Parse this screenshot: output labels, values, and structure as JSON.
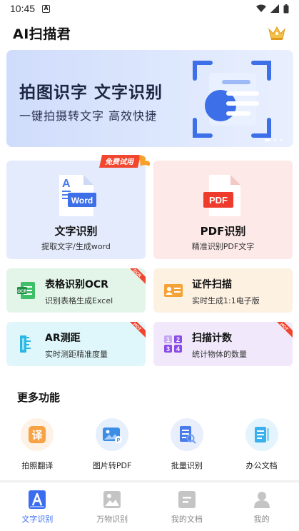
{
  "status_bar": {
    "time": "10:45",
    "notification_badge": "A"
  },
  "app": {
    "title": "AI扫描君"
  },
  "banner": {
    "headline": "拍图识字  文字识别",
    "subline": "一键拍摄转文字  高效快捷"
  },
  "main_cards": [
    {
      "name": "文字识别",
      "desc": "提取文字/生成word",
      "icon": "word-doc-icon",
      "icon_text": "Word",
      "tag": "免费试用"
    },
    {
      "name": "PDF识别",
      "desc": "精准识别PDF文字",
      "icon": "pdf-doc-icon",
      "icon_text": "PDF"
    }
  ],
  "tools": [
    {
      "name": "表格识别OCR",
      "desc": "识别表格生成Excel",
      "icon": "excel-icon",
      "ribbon": "OCR"
    },
    {
      "name": "证件扫描",
      "desc": "实时生成1:1电子版",
      "icon": "id-card-icon"
    },
    {
      "name": "AR测距",
      "desc": "实时测距精准度量",
      "icon": "ruler-icon",
      "ribbon": "HOT"
    },
    {
      "name": "扫描计数",
      "desc": "统计物体的数量",
      "icon": "counter-icon",
      "icon_digits": [
        "1",
        "2",
        "3",
        "4"
      ],
      "ribbon": "HOT"
    }
  ],
  "more": {
    "title": "更多功能",
    "items": [
      {
        "label": "拍照翻译",
        "icon": "translate-icon",
        "glyph": "译"
      },
      {
        "label": "图片转PDF",
        "icon": "image-to-pdf-icon"
      },
      {
        "label": "批量识别",
        "icon": "batch-scan-icon"
      },
      {
        "label": "办公文档",
        "icon": "office-doc-icon"
      }
    ]
  },
  "tabs": [
    {
      "label": "文字识别",
      "icon": "text-a-icon",
      "active": true
    },
    {
      "label": "万物识别",
      "icon": "image-icon",
      "active": false
    },
    {
      "label": "我的文档",
      "icon": "document-icon",
      "active": false
    },
    {
      "label": "我的",
      "icon": "person-icon",
      "active": false
    }
  ],
  "colors": {
    "accent": "#3a6df0",
    "tab_inactive": "#bbbbbb"
  }
}
